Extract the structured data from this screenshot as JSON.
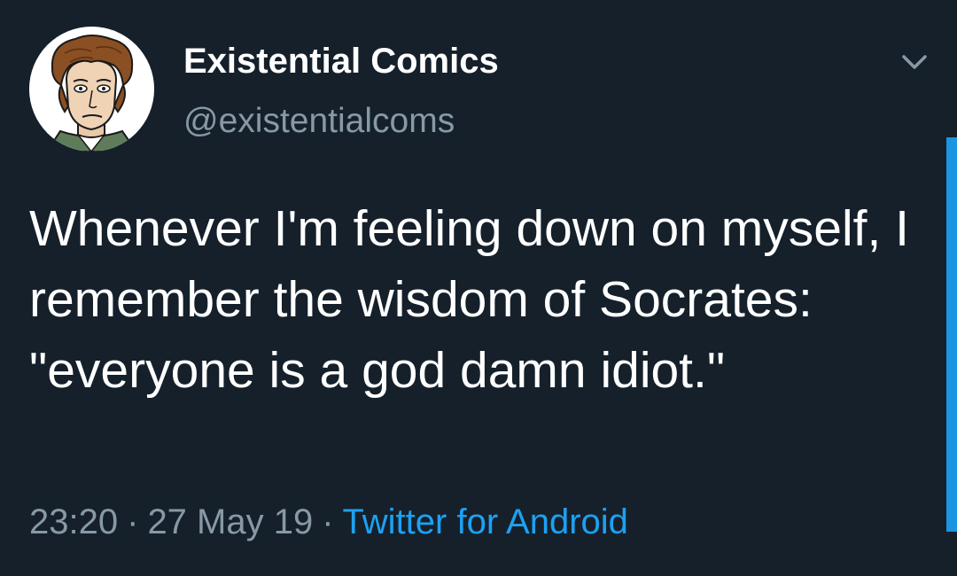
{
  "tweet": {
    "author": {
      "name": "Existential Comics",
      "handle": "@existentialcoms"
    },
    "text": "Whenever I'm feeling down on myself, I remember the wisdom of Socrates: \"everyone is a god damn idiot.\"",
    "meta": {
      "time": "23:20",
      "date": "27 May 19",
      "separator": "·",
      "source": "Twitter for Android"
    }
  },
  "icons": {
    "menu_caret": "chevron-down-icon",
    "avatar": "avatar"
  },
  "colors": {
    "background": "#15202b",
    "text": "#ffffff",
    "secondary_text": "#8899a6",
    "accent": "#1da1f2",
    "scrollbar": "#1b95e0"
  }
}
